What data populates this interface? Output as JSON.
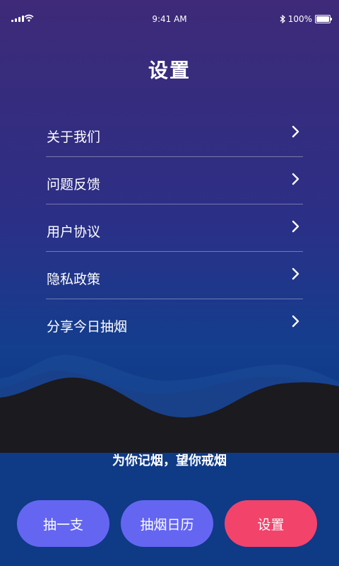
{
  "status_bar": {
    "time": "9:41 AM",
    "battery": "100%",
    "battery_level": 1.0
  },
  "page": {
    "title": "设置"
  },
  "menu": {
    "items": [
      {
        "label": "关于我们"
      },
      {
        "label": "问题反馈"
      },
      {
        "label": "用户协议"
      },
      {
        "label": "隐私政策"
      },
      {
        "label": "分享今日抽烟"
      }
    ]
  },
  "slogan": "为你记烟，望你戒烟",
  "bottom_nav": {
    "smoke_one_label": "抽一支",
    "calendar_label": "抽烟日历",
    "settings_label": "设置"
  },
  "colors": {
    "button_blue": "#6466f2",
    "button_active": "#f2436b",
    "gradient_top": "#3e2a78",
    "gradient_bottom": "#0f3a86",
    "ground": "#1b1a1f"
  },
  "icons": [
    "signal-icon",
    "wifi-icon",
    "bluetooth-icon",
    "battery-icon",
    "chevron-right-icon"
  ]
}
